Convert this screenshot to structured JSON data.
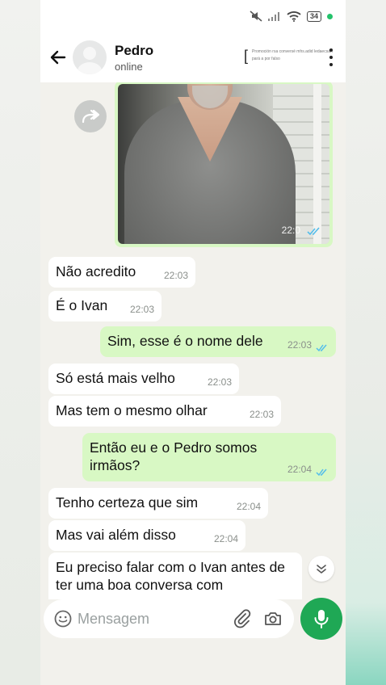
{
  "statusbar": {
    "battery": "34"
  },
  "header": {
    "contact_name": "Pedro",
    "contact_status": "online",
    "ad_line1": "Promoción rsa conversé mhs.adid ledaecsán",
    "ad_line2": "pará a por falso"
  },
  "photo_message": {
    "time": "22:0"
  },
  "messages": [
    {
      "direction": "in",
      "text": "Não acredito",
      "time": "22:03"
    },
    {
      "direction": "in",
      "text": "É o Ivan",
      "time": "22:03"
    },
    {
      "direction": "out",
      "text": "Sim, esse é o nome dele",
      "time": "22:03",
      "status": "read"
    },
    {
      "direction": "in",
      "text": "Só está mais velho",
      "time": "22:03"
    },
    {
      "direction": "in",
      "text": "Mas tem o mesmo olhar",
      "time": "22:03"
    },
    {
      "direction": "out",
      "text": "Então eu e o Pedro somos irmãos?",
      "time": "22:04",
      "status": "read"
    },
    {
      "direction": "in",
      "text": "Tenho certeza que sim",
      "time": "22:04"
    },
    {
      "direction": "in",
      "text": "Mas vai além disso",
      "time": "22:04"
    },
    {
      "direction": "in",
      "text": "Eu preciso falar com o Ivan antes de ter uma boa conversa com",
      "time": ""
    }
  ],
  "composer": {
    "placeholder": "Mensagem"
  },
  "colors": {
    "accent": "#1fa855",
    "outgoing_bubble": "#d8f8c4",
    "read_ticks": "#53bdeb"
  },
  "icons": [
    "back-arrow-icon",
    "forward-icon",
    "menu-dots-icon",
    "emoji-icon",
    "attach-icon",
    "camera-icon",
    "mic-icon",
    "chevron-down-icon"
  ]
}
